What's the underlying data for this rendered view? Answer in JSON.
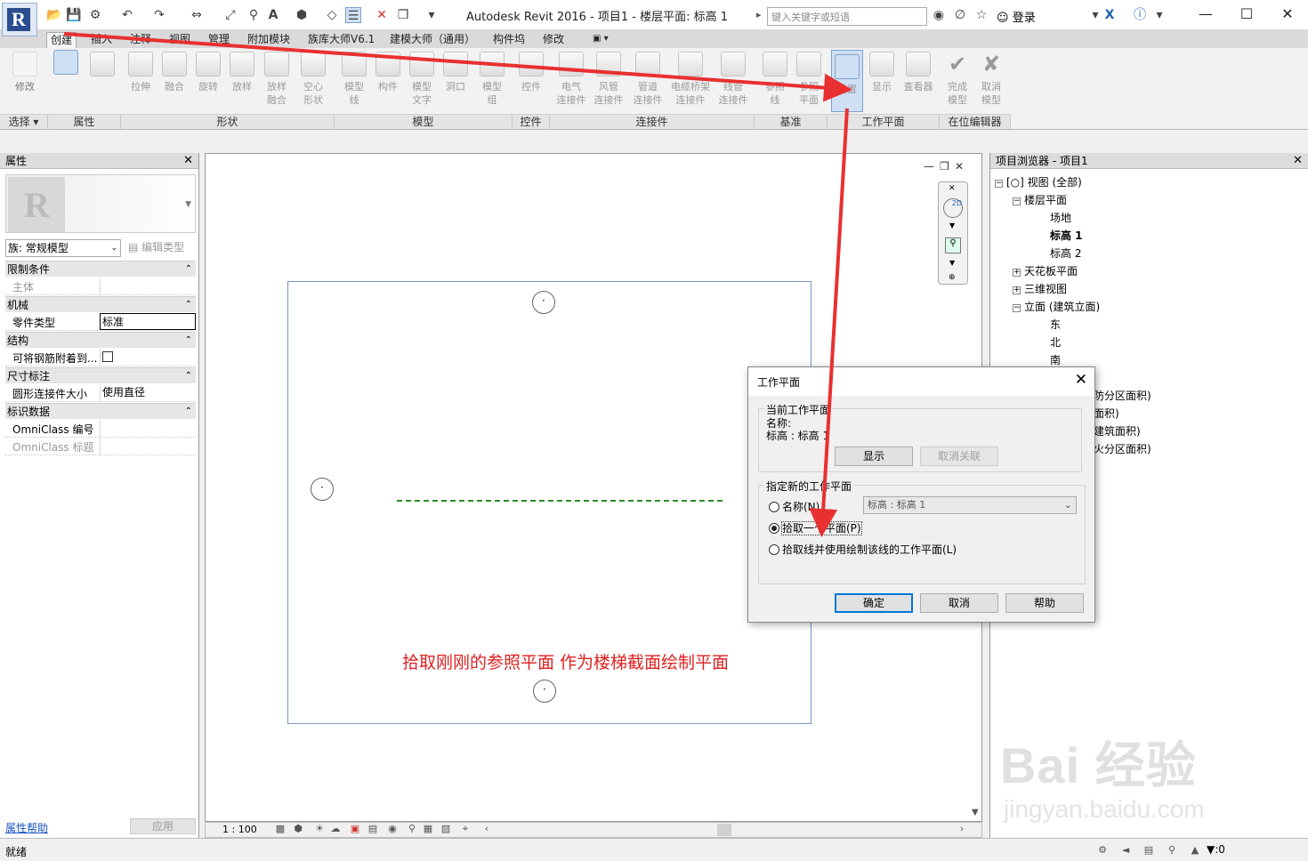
{
  "app": {
    "title": "Autodesk Revit 2016 -     项目1 - 楼层平面: 标高 1",
    "search_placeholder": "键入关键字或短语",
    "login": "登录"
  },
  "ribbon_tabs": [
    "创建",
    "插入",
    "注释",
    "视图",
    "管理",
    "附加模块",
    "族库大师V6.1",
    "建模大师（通用）",
    "构件坞",
    "修改"
  ],
  "ribbon": {
    "modify": "修改",
    "select": "选择 ▾",
    "properties": "属性",
    "form_buttons": [
      "拉伸",
      "融合",
      "旋转",
      "放样",
      "放样\n融合",
      "空心\n形状"
    ],
    "form_panel": "形状",
    "model_buttons": [
      "模型\n线",
      "构件",
      "模型\n文字",
      "洞口",
      "模型\n组"
    ],
    "model_panel": "模型",
    "control_button": "控件",
    "control_panel": "控件",
    "connector_buttons": [
      "电气\n连接件",
      "风管\n连接件",
      "管道\n连接件",
      "电缆桥架\n连接件",
      "线管\n连接件"
    ],
    "connector_panel": "连接件",
    "datum_buttons": [
      "参照\n线",
      "参照\n平面"
    ],
    "datum_panel": "基准",
    "workplane_buttons": [
      "设置",
      "显示",
      "查看器"
    ],
    "workplane_panel": "工作平面",
    "inplace_buttons": [
      "完成\n模型",
      "取消\n模型"
    ],
    "inplace_panel": "在位编辑器"
  },
  "properties": {
    "header": "属性",
    "family": "族: 常规模型",
    "edit_type": "编辑类型",
    "groups": [
      {
        "name": "限制条件",
        "rows": [
          {
            "k": "主体",
            "v": "",
            "dim": true
          }
        ]
      },
      {
        "name": "机械",
        "rows": [
          {
            "k": "零件类型",
            "v": "标准",
            "dim": false
          }
        ]
      },
      {
        "name": "结构",
        "rows": [
          {
            "k": "可将钢筋附着到...",
            "v": "",
            "dim": false
          }
        ]
      },
      {
        "name": "尺寸标注",
        "rows": [
          {
            "k": "圆形连接件大小",
            "v": "使用直径",
            "dim": false
          }
        ]
      },
      {
        "name": "标识数据",
        "rows": [
          {
            "k": "OmniClass 编号",
            "v": "",
            "dim": false
          },
          {
            "k": "OmniClass 标题",
            "v": "",
            "dim": true
          }
        ]
      }
    ],
    "help_link": "属性帮助",
    "apply": "应用"
  },
  "canvas": {
    "note": "拾取刚刚的参照平面  作为楼梯截面绘制平面",
    "scale": "1 : 100"
  },
  "browser": {
    "header": "项目浏览器 - 项目1",
    "items": [
      {
        "label": "[○] 视图 (全部)",
        "sign": "−"
      },
      {
        "label": "楼层平面",
        "sign": "−"
      },
      {
        "label": "场地",
        "sign": ""
      },
      {
        "label": "标高 1",
        "sign": ""
      },
      {
        "label": "标高 2",
        "sign": ""
      },
      {
        "label": "天花板平面",
        "sign": "+"
      },
      {
        "label": "三维视图",
        "sign": "+"
      },
      {
        "label": "立面 (建筑立面)",
        "sign": "−"
      },
      {
        "label": "东",
        "sign": ""
      },
      {
        "label": "北",
        "sign": ""
      },
      {
        "label": "南",
        "sign": ""
      }
    ],
    "partial_items": [
      "防分区面积)",
      "面积)",
      "建筑面积)",
      "火分区面积)"
    ],
    "watermark": "Bai 经验",
    "watermark_url": "jingyan.baidu.com"
  },
  "dialog": {
    "title": "工作平面",
    "current_legend": "当前工作平面",
    "name_label": "名称:",
    "name_value": "标高 : 标高 1",
    "show_btn": "显示",
    "dissociate_btn": "取消关联",
    "specify_legend": "指定新的工作平面",
    "opt_name": "名称(N)",
    "level_select": "标高 : 标高 1",
    "opt_pick_plane": "拾取一个平面(P)",
    "opt_pick_line": "拾取线并使用绘制该线的工作平面(L)",
    "ok": "确定",
    "cancel": "取消",
    "help": "帮助"
  },
  "status": {
    "text": "就绪",
    "filter_count": ":0"
  },
  "colors": {
    "annotation_red": "#e02020",
    "reference_plane_green": "#2a8a2a",
    "sheet_border_blue": "#7b93c8"
  }
}
